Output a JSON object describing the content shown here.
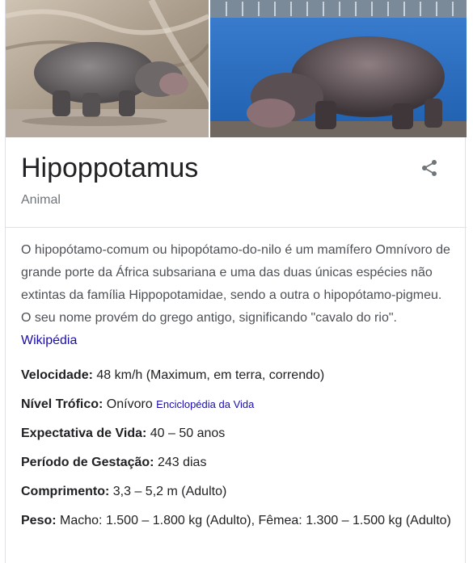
{
  "entity": {
    "title": "Hipoppotamus",
    "subtitle": "Animal"
  },
  "description": {
    "text": "O hipopótamo-comum ou hipopótamo-do-nilo é um mamífero Omnívoro de grande porte da África subsariana e uma das duas únicas espécies não extintas da família Hippopotamidae, sendo a outra o hipopótamo-pigmeu. O seu nome provém do grego antigo, significando \"cavalo do rio\". ",
    "source_link": "Wikipédia"
  },
  "facts": [
    {
      "label": "Velocidade:",
      "value": " 48 km/h (Maximum, em terra, correndo)",
      "source": ""
    },
    {
      "label": "Nível Trófico:",
      "value": " Onívoro ",
      "source": "Enciclopédia da Vida"
    },
    {
      "label": "Expectativa de Vida:",
      "value": " 40 – 50 anos",
      "source": ""
    },
    {
      "label": "Período de Gestação:",
      "value": " 243 dias",
      "source": ""
    },
    {
      "label": "Comprimento:",
      "value": " 3,3 – 5,2 m (Adulto)",
      "source": ""
    },
    {
      "label": "Peso:",
      "value": " Macho: 1.500 – 1.800 kg (Adulto), Fêmea: 1.300 – 1.500 kg (Adulto)",
      "source": ""
    }
  ],
  "icons": {
    "share": "share-icon"
  },
  "colors": {
    "link": "#1a0dab",
    "title": "#202124",
    "muted": "#70757a",
    "border": "#dfe1e5"
  }
}
